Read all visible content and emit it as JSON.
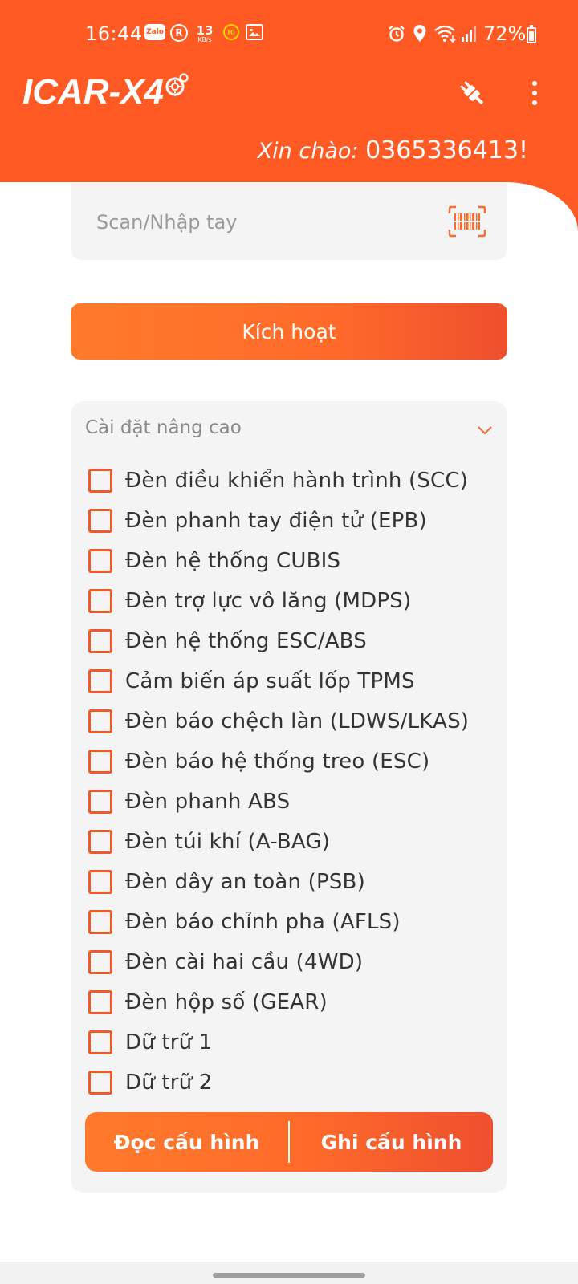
{
  "status_bar": {
    "time": "16:44",
    "zalo_label": "Zalo",
    "app_r_label": "R",
    "net_speed_value": "13",
    "net_speed_unit": "KB/s",
    "hi_label": "Hi",
    "battery": "72%"
  },
  "app_bar": {
    "logo": "ICAR-X4",
    "greeting_prefix": "Xin chào: ",
    "phone": "0365336413!"
  },
  "scan": {
    "placeholder": "Scan/Nhập tay",
    "value": ""
  },
  "activate_button": "Kích hoạt",
  "advanced": {
    "title": "Cài đặt nâng cao",
    "options": [
      {
        "label": "Đèn điều khiển hành trình (SCC)",
        "checked": false
      },
      {
        "label": "Đèn phanh tay điện tử (EPB)",
        "checked": false
      },
      {
        "label": "Đèn hệ thống CUBIS",
        "checked": false
      },
      {
        "label": "Đèn trợ lực vô lăng (MDPS)",
        "checked": false
      },
      {
        "label": "Đèn hệ thống ESC/ABS",
        "checked": false
      },
      {
        "label": "Cảm biến áp suất lốp TPMS",
        "checked": false
      },
      {
        "label": "Đèn báo chệch làn (LDWS/LKAS)",
        "checked": false
      },
      {
        "label": "Đèn báo hệ thống treo (ESC)",
        "checked": false
      },
      {
        "label": "Đèn phanh ABS",
        "checked": false
      },
      {
        "label": "Đèn túi khí (A-BAG)",
        "checked": false
      },
      {
        "label": "Đèn dây an toàn (PSB)",
        "checked": false
      },
      {
        "label": "Đèn báo chỉnh pha (AFLS)",
        "checked": false
      },
      {
        "label": "Đèn cài hai cầu (4WD)",
        "checked": false
      },
      {
        "label": "Đèn hộp số (GEAR)",
        "checked": false
      },
      {
        "label": "Dữ trữ 1",
        "checked": false
      },
      {
        "label": "Dữ trữ 2",
        "checked": false
      }
    ],
    "read_button": "Đọc cấu hình",
    "write_button": "Ghi cấu hình"
  },
  "colors": {
    "brand": "#ff5a24",
    "card_bg": "#f4f4f4",
    "checkbox_border": "#ef5a2a"
  }
}
